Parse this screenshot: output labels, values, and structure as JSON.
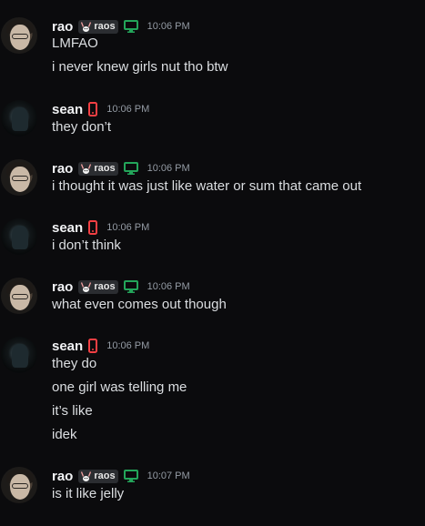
{
  "messages": [
    {
      "user": "rao",
      "tag": "raos",
      "device": "desktop",
      "time": "10:06 PM",
      "lines": [
        "LMFAO",
        "i never knew girls nut tho btw"
      ]
    },
    {
      "user": "sean",
      "tag": "",
      "device": "mobile",
      "time": "10:06 PM",
      "lines": [
        "they don’t"
      ]
    },
    {
      "user": "rao",
      "tag": "raos",
      "device": "desktop",
      "time": "10:06 PM",
      "lines": [
        "i thought it was just like water or sum that came out"
      ]
    },
    {
      "user": "sean",
      "tag": "",
      "device": "mobile",
      "time": "10:06 PM",
      "lines": [
        "i don’t think"
      ]
    },
    {
      "user": "rao",
      "tag": "raos",
      "device": "desktop",
      "time": "10:06 PM",
      "lines": [
        "what even comes out though"
      ]
    },
    {
      "user": "sean",
      "tag": "",
      "device": "mobile",
      "time": "10:06 PM",
      "lines": [
        "they do",
        "one girl was telling me",
        "it’s like",
        "idek"
      ]
    },
    {
      "user": "rao",
      "tag": "raos",
      "device": "desktop",
      "time": "10:07 PM",
      "lines": [
        "is it like jelly"
      ]
    }
  ],
  "colors": {
    "background": "#0b0b0d",
    "desktop_icon": "#23a55a",
    "mobile_icon": "#f23f43",
    "timestamp": "#949ba4"
  }
}
